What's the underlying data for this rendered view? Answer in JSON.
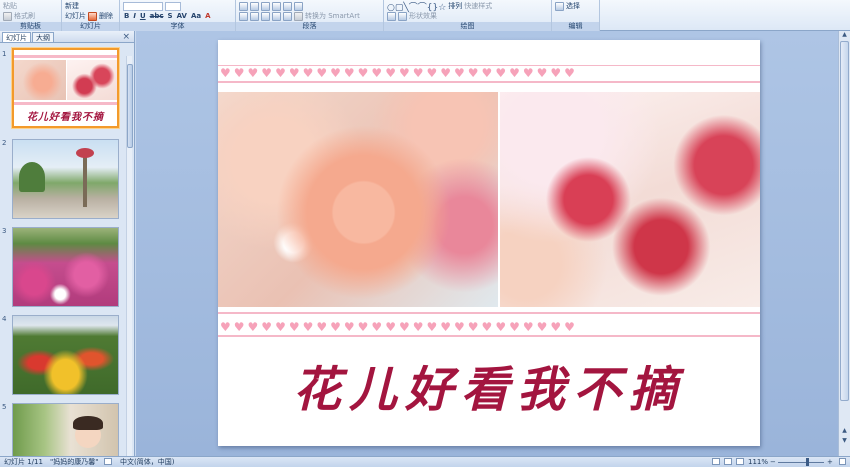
{
  "ribbon": {
    "clipboard": {
      "paste": "粘贴",
      "format_painter": "格式刷",
      "label": "剪贴板"
    },
    "slides": {
      "new_slide_line1": "新建",
      "new_slide_line2": "幻灯片",
      "delete": "删除",
      "label": "幻灯片"
    },
    "font": {
      "bold": "B",
      "italic": "I",
      "underline": "U",
      "strike": "abc",
      "shadow": "S",
      "spacing": "AV",
      "case": "Aa",
      "color": "A",
      "label": "字体"
    },
    "paragraph": {
      "convert_smartart": "转换为 SmartArt",
      "label": "段落"
    },
    "drawing": {
      "arrange": "排列",
      "quick_styles": "快速样式",
      "shape_effects": "形状效果",
      "shapes": "○▢╲⌒⌒{}☆",
      "label": "绘图"
    },
    "editing": {
      "select": "选择",
      "label": "编辑"
    }
  },
  "panel": {
    "tabs": [
      "幻灯片",
      "大纲"
    ],
    "close": "×",
    "thumbnails": [
      {
        "num": "1",
        "caption": "花儿好看我不摘"
      },
      {
        "num": "2"
      },
      {
        "num": "3"
      },
      {
        "num": "4"
      },
      {
        "num": "5"
      }
    ]
  },
  "slide": {
    "title": "花儿好看我不摘",
    "heart_glyph": "♥"
  },
  "status": {
    "slide_index": "幻灯片 1/11",
    "theme": "\"妈妈的康乃馨\"",
    "language": "中文(简体，中国)",
    "zoom": "111%",
    "zoom_minus": "−",
    "zoom_plus": "+"
  },
  "colors": {
    "title": "#a3153f",
    "heart": "#f6a2b9",
    "selection": "#f39a2b"
  }
}
